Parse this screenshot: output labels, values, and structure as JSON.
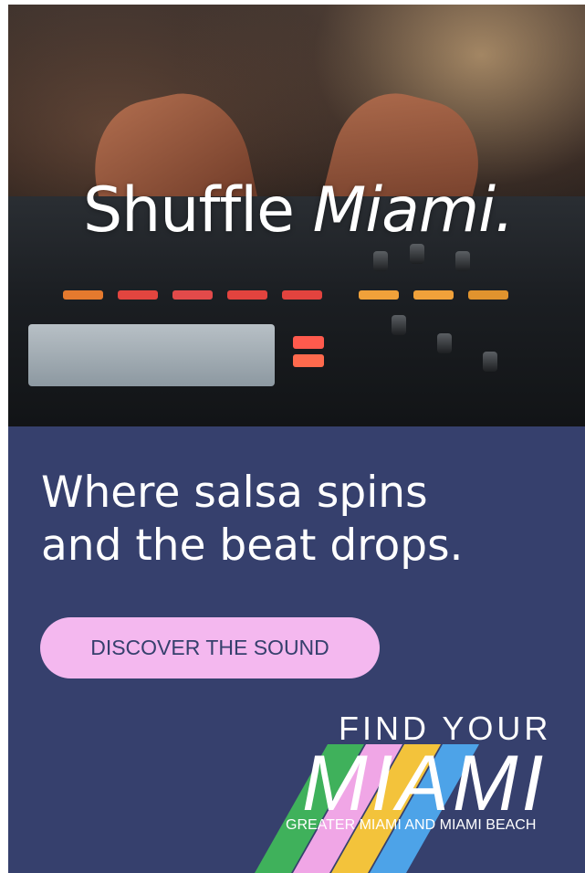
{
  "hero": {
    "title_main": "Shuffle",
    "title_accent": "Miami."
  },
  "headline": {
    "line1": "Where salsa spins",
    "line2": "and the beat drops."
  },
  "cta": {
    "label": "DISCOVER THE SOUND"
  },
  "logo": {
    "top_text": "FIND YOUR",
    "wordmark": "MIAMI",
    "subtitle": "GREATER MIAMI AND MIAMI BEACH"
  },
  "colors": {
    "background": "#36406d",
    "button": "#f4b8ef",
    "stripe_green": "#3fb15b",
    "stripe_pink": "#f0a6e6",
    "stripe_yellow": "#f3c33b",
    "stripe_blue": "#4da3e8"
  }
}
